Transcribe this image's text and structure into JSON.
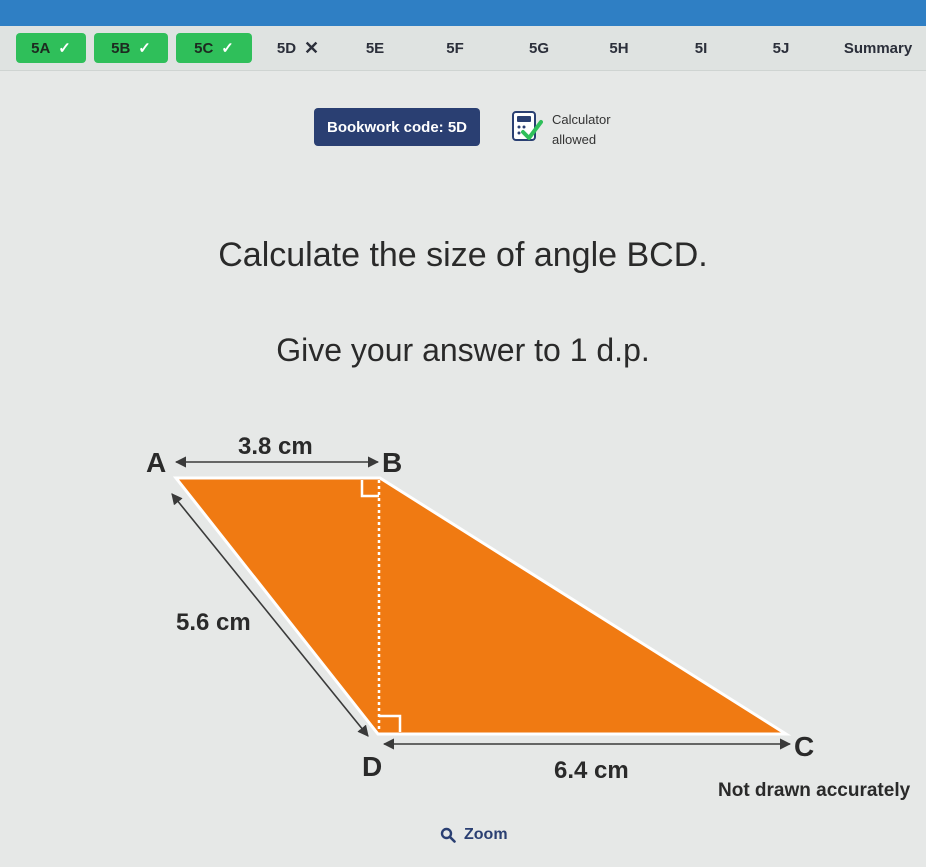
{
  "tabs": [
    {
      "label": "5A",
      "status": "done",
      "mark": "✓"
    },
    {
      "label": "5B",
      "status": "done",
      "mark": "✓"
    },
    {
      "label": "5C",
      "status": "done",
      "mark": "✓"
    },
    {
      "label": "5D",
      "status": "wrong",
      "mark": "✕"
    },
    {
      "label": "5E",
      "status": "none",
      "mark": ""
    },
    {
      "label": "5F",
      "status": "none",
      "mark": ""
    },
    {
      "label": "5G",
      "status": "none",
      "mark": ""
    },
    {
      "label": "5H",
      "status": "none",
      "mark": ""
    },
    {
      "label": "5I",
      "status": "none",
      "mark": ""
    },
    {
      "label": "5J",
      "status": "none",
      "mark": ""
    },
    {
      "label": "Summary",
      "status": "none",
      "mark": ""
    }
  ],
  "bookwork": {
    "label": "Bookwork code: 5D"
  },
  "calculator": {
    "line1": "Calculator",
    "line2": "allowed",
    "icon": "calculator-icon"
  },
  "question": {
    "line1": "Calculate the size of angle BCD.",
    "line2": "Give your answer to 1 d.p."
  },
  "diagram": {
    "labels": {
      "A": "A",
      "B": "B",
      "C": "C",
      "D": "D"
    },
    "ab": "3.8 cm",
    "ad": "5.6 cm",
    "dc": "6.4 cm",
    "note": "Not drawn accurately",
    "fill": "#f07a12"
  },
  "zoom": {
    "label": "Zoom",
    "icon": "magnifier-icon"
  },
  "colors": {
    "header": "#2f7fc4",
    "done": "#2fbf5a",
    "bookwork": "#2a3f72"
  }
}
